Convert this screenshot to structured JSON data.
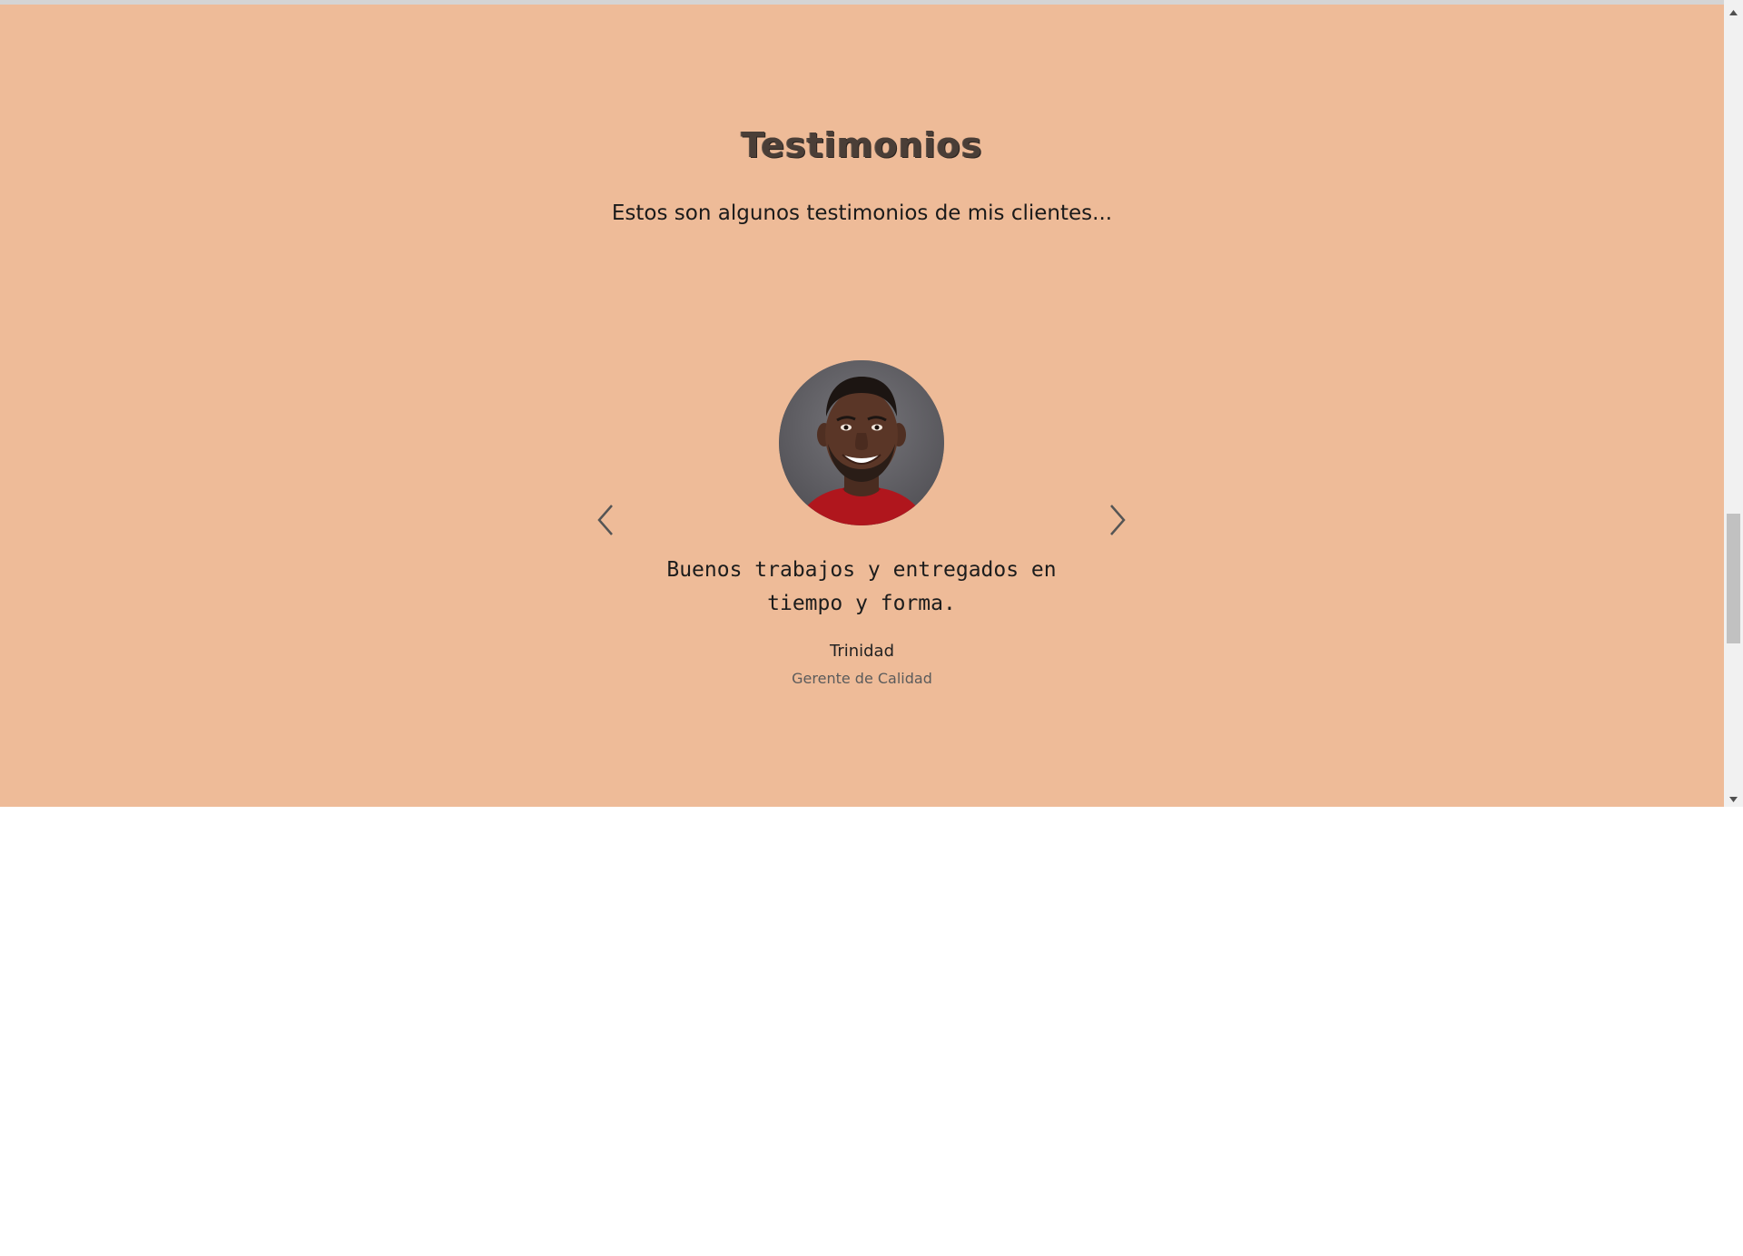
{
  "section": {
    "title": "Testimonios",
    "subtitle": "Estos son algunos testimonios de mis clientes..."
  },
  "testimonial": {
    "quote": "Buenos trabajos y entregados en tiempo y forma.",
    "name": "Trinidad",
    "role": "Gerente de Calidad"
  },
  "carousel": {
    "prev_icon": "chevron-left-icon",
    "next_icon": "chevron-right-icon"
  },
  "colors": {
    "section_background": "#eebb98",
    "page_background": "#ffffff"
  }
}
